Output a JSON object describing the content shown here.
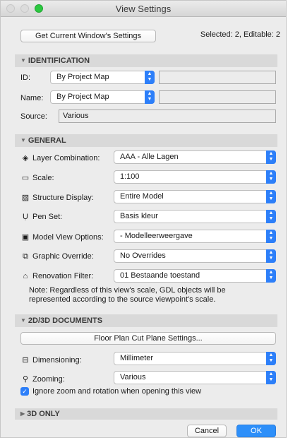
{
  "window": {
    "title": "View Settings"
  },
  "toolbar": {
    "get_settings_label": "Get Current Window's Settings",
    "selection_info": "Selected: 2, Editable: 2"
  },
  "identification": {
    "header": "IDENTIFICATION",
    "id": {
      "label": "ID:",
      "value": "By Project Map"
    },
    "name": {
      "label": "Name:",
      "value": "By Project Map"
    },
    "source": {
      "label": "Source:",
      "value": "Various"
    }
  },
  "general": {
    "header": "GENERAL",
    "rows": [
      {
        "label": "Layer Combination:",
        "value": "AAA - Alle Lagen",
        "icon": "layers-icon"
      },
      {
        "label": "Scale:",
        "value": "1:100",
        "icon": "ruler-icon"
      },
      {
        "label": "Structure Display:",
        "value": "Entire Model",
        "icon": "hatch-icon"
      },
      {
        "label": "Pen Set:",
        "value": "Basis kleur",
        "icon": "pen-icon"
      },
      {
        "label": "Model View Options:",
        "value": "- Modelleerweergave",
        "icon": "model-view-icon"
      },
      {
        "label": "Graphic Override:",
        "value": "No Overrides",
        "icon": "graphic-override-icon"
      },
      {
        "label": "Renovation Filter:",
        "value": "01 Bestaande toestand",
        "icon": "renovation-icon"
      }
    ],
    "note": "Note: Regardless of this view's scale, GDL objects will be represented according to the source viewpoint's scale."
  },
  "documents": {
    "header": "2D/3D DOCUMENTS",
    "floor_plan_button": "Floor Plan Cut Plane Settings...",
    "dimensioning": {
      "label": "Dimensioning:",
      "value": "Millimeter"
    },
    "zooming": {
      "label": "Zooming:",
      "value": "Various"
    },
    "ignore_zoom_label": "Ignore zoom and rotation when opening this view",
    "ignore_zoom_checked": true
  },
  "three_d": {
    "header": "3D ONLY"
  },
  "footer": {
    "cancel_label": "Cancel",
    "ok_label": "OK"
  },
  "colors": {
    "accent": "#2d7ff9",
    "section_bg": "#d9d9d9",
    "window_bg": "#ececec"
  }
}
